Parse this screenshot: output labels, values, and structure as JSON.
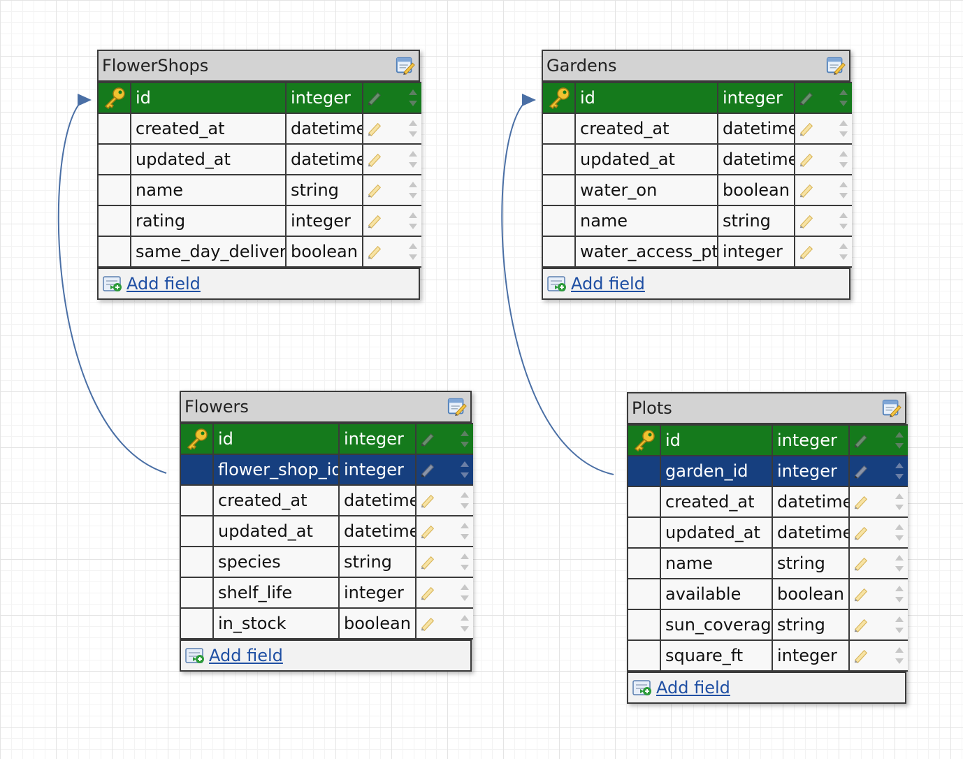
{
  "colors": {
    "primary_key_row": "#157a1c",
    "foreign_key_row": "#163f7f",
    "header": "#d3d3d3",
    "connector": "#4a6fa5"
  },
  "tables": [
    {
      "id": "flowershops",
      "name": "FlowerShops",
      "add_field_label": "Add field",
      "fields": [
        {
          "name": "id",
          "type": "integer",
          "key": "primary"
        },
        {
          "name": "created_at",
          "type": "datetime",
          "key": "none"
        },
        {
          "name": "updated_at",
          "type": "datetime",
          "key": "none"
        },
        {
          "name": "name",
          "type": "string",
          "key": "none"
        },
        {
          "name": "rating",
          "type": "integer",
          "key": "none"
        },
        {
          "name": "same_day_delivery",
          "type": "boolean",
          "key": "none"
        }
      ]
    },
    {
      "id": "gardens",
      "name": "Gardens",
      "add_field_label": "Add field",
      "fields": [
        {
          "name": "id",
          "type": "integer",
          "key": "primary"
        },
        {
          "name": "created_at",
          "type": "datetime",
          "key": "none"
        },
        {
          "name": "updated_at",
          "type": "datetime",
          "key": "none"
        },
        {
          "name": "water_on",
          "type": "boolean",
          "key": "none"
        },
        {
          "name": "name",
          "type": "string",
          "key": "none"
        },
        {
          "name": "water_access_pts",
          "type": "integer",
          "key": "none"
        }
      ]
    },
    {
      "id": "flowers",
      "name": "Flowers",
      "add_field_label": "Add field",
      "fields": [
        {
          "name": "id",
          "type": "integer",
          "key": "primary"
        },
        {
          "name": "flower_shop_id",
          "type": "integer",
          "key": "foreign"
        },
        {
          "name": "created_at",
          "type": "datetime",
          "key": "none"
        },
        {
          "name": "updated_at",
          "type": "datetime",
          "key": "none"
        },
        {
          "name": "species",
          "type": "string",
          "key": "none"
        },
        {
          "name": "shelf_life",
          "type": "integer",
          "key": "none"
        },
        {
          "name": "in_stock",
          "type": "boolean",
          "key": "none"
        }
      ]
    },
    {
      "id": "plots",
      "name": "Plots",
      "add_field_label": "Add field",
      "fields": [
        {
          "name": "id",
          "type": "integer",
          "key": "primary"
        },
        {
          "name": "garden_id",
          "type": "integer",
          "key": "foreign"
        },
        {
          "name": "created_at",
          "type": "datetime",
          "key": "none"
        },
        {
          "name": "updated_at",
          "type": "datetime",
          "key": "none"
        },
        {
          "name": "name",
          "type": "string",
          "key": "none"
        },
        {
          "name": "available",
          "type": "boolean",
          "key": "none"
        },
        {
          "name": "sun_coverage",
          "type": "string",
          "key": "none"
        },
        {
          "name": "square_ft",
          "type": "integer",
          "key": "none"
        }
      ]
    }
  ],
  "relations": [
    {
      "from_table": "flowers",
      "from_field": "flower_shop_id",
      "to_table": "flowershops",
      "to_field": "id"
    },
    {
      "from_table": "plots",
      "from_field": "garden_id",
      "to_table": "gardens",
      "to_field": "id"
    }
  ]
}
